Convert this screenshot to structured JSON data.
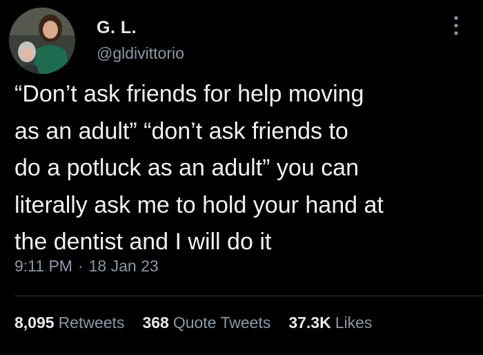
{
  "user": {
    "display_name": "G. L.",
    "handle": "@gldivittorio"
  },
  "tweet": {
    "lines": [
      "“Don’t ask friends for help moving",
      "as an adult” “don’t ask friends to",
      "do a potluck as an adult” you can",
      "literally ask me to hold your hand at",
      "the dentist and I will do it"
    ],
    "time": "9:11 PM",
    "separator": "·",
    "date": "18 Jan 23"
  },
  "stats": {
    "retweets_count": "8,095",
    "retweets_label": "Retweets",
    "quotes_count": "368",
    "quotes_label": "Quote Tweets",
    "likes_count": "37.3K",
    "likes_label": "Likes"
  },
  "icons": {
    "more": "more-vertical-icon"
  },
  "colors": {
    "background": "#000000",
    "primary_text": "#e7e9ea",
    "secondary_text": "#8b98a5",
    "divider": "#2f3336"
  }
}
